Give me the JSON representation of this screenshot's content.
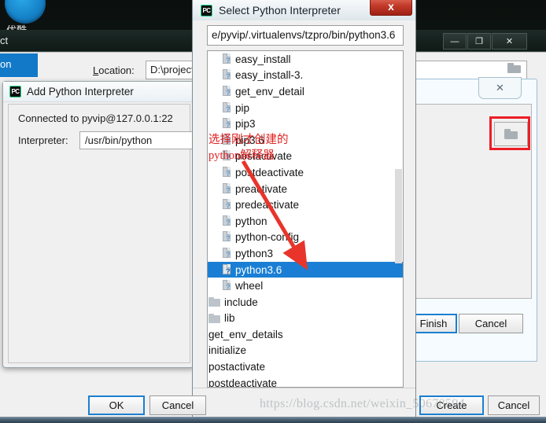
{
  "desktop": {
    "youku_label": "优酷",
    "ide_tab_label": "ct",
    "ide_title": "",
    "window_buttons": {
      "minimize": "—",
      "maximize": "❐",
      "close": "✕"
    }
  },
  "settings_panel": {
    "sidebar_selected_label": "on",
    "location_label": "Location:",
    "location_value": "D:\\project\\tzpr",
    "folder_icon": "folder-icon",
    "browse_button_icon": "folder-open-icon",
    "env_close_label": "✕",
    "finish_button": "Finish",
    "cancel_button": "Cancel",
    "create_button": "Create",
    "cancel_button_2": "Cancel"
  },
  "add_interpreter_dialog": {
    "app_badge": "PC",
    "title": "Add Python Interpreter",
    "connected_text": "Connected to pyvip@127.0.0.1:22",
    "interpreter_label": "Interpreter:",
    "interpreter_value": "/usr/bin/python"
  },
  "select_dialog": {
    "app_badge": "PC",
    "title": "Select Python Interpreter",
    "close_label": "x",
    "path_value": "e/pyvip/.virtualenvs/tzpro/bin/python3.6",
    "ok_button": "OK",
    "cancel_button": "Cancel",
    "files": [
      {
        "name": "easy_install",
        "icon": "script-file-icon",
        "indent": 0,
        "twisty": "",
        "selected": false
      },
      {
        "name": "easy_install-3.",
        "icon": "script-file-icon",
        "indent": 0,
        "twisty": "",
        "selected": false
      },
      {
        "name": "get_env_detail",
        "icon": "script-file-icon",
        "indent": 0,
        "twisty": "",
        "selected": false
      },
      {
        "name": "pip",
        "icon": "script-file-icon",
        "indent": 0,
        "twisty": "",
        "selected": false
      },
      {
        "name": "pip3",
        "icon": "script-file-icon",
        "indent": 0,
        "twisty": "",
        "selected": false
      },
      {
        "name": "pip3.6",
        "icon": "script-file-icon",
        "indent": 0,
        "twisty": "",
        "selected": false
      },
      {
        "name": "postactivate",
        "icon": "script-file-icon",
        "indent": 0,
        "twisty": "",
        "selected": false
      },
      {
        "name": "postdeactivate",
        "icon": "script-file-icon",
        "indent": 0,
        "twisty": "",
        "selected": false
      },
      {
        "name": "preactivate",
        "icon": "script-file-icon",
        "indent": 0,
        "twisty": "",
        "selected": false
      },
      {
        "name": "predeactivate",
        "icon": "script-file-icon",
        "indent": 0,
        "twisty": "",
        "selected": false
      },
      {
        "name": "python",
        "icon": "script-file-icon",
        "indent": 0,
        "twisty": "",
        "selected": false
      },
      {
        "name": "python-config",
        "icon": "script-file-icon",
        "indent": 0,
        "twisty": "",
        "selected": false
      },
      {
        "name": "python3",
        "icon": "script-file-icon",
        "indent": 0,
        "twisty": "",
        "selected": false
      },
      {
        "name": "python3.6",
        "icon": "script-file-icon",
        "indent": 0,
        "twisty": "",
        "selected": true
      },
      {
        "name": "wheel",
        "icon": "script-file-icon",
        "indent": 0,
        "twisty": "",
        "selected": false
      },
      {
        "name": "include",
        "icon": "folder-icon",
        "indent": -1,
        "twisty": "›",
        "selected": false
      },
      {
        "name": "lib",
        "icon": "folder-icon",
        "indent": -1,
        "twisty": "›",
        "selected": false
      },
      {
        "name": "get_env_details",
        "icon": "script-file-icon",
        "indent": -2,
        "twisty": "",
        "selected": false
      },
      {
        "name": "initialize",
        "icon": "script-file-icon",
        "indent": -2,
        "twisty": "",
        "selected": false
      },
      {
        "name": "postactivate",
        "icon": "script-file-icon",
        "indent": -2,
        "twisty": "",
        "selected": false
      },
      {
        "name": "postdeactivate",
        "icon": "script-file-icon",
        "indent": -2,
        "twisty": "",
        "selected": false
      }
    ]
  },
  "annotation": {
    "line1": "选择刚才创建的",
    "line2_mono": "python",
    "line2_rest": "解释器",
    "arrow_color": "#e8342a",
    "text_color": "#e02020",
    "highlight_color": "#ee1c25"
  },
  "watermark": {
    "text": "https://blog.csdn.net/weixin_50678594"
  },
  "colors": {
    "selection_blue": "#1a7fd4",
    "accent_blue": "#1b7fd0",
    "dialog_bg": "#f0f0f0",
    "red_highlight": "#ee1c25"
  }
}
